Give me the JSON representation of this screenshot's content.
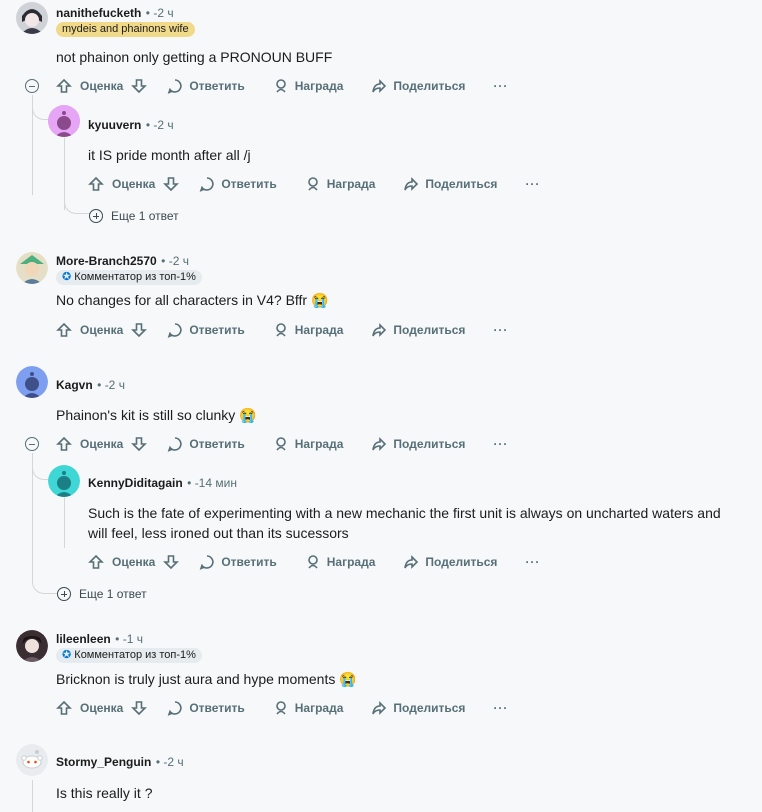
{
  "actions": {
    "vote": "Оценка",
    "reply": "Ответить",
    "award": "Награда",
    "share": "Поделиться",
    "more": "···"
  },
  "comments": [
    {
      "user": "nanithefucketh",
      "time": "-2 ч",
      "flair": "mydeis and phainons wife",
      "text": "not phainon only getting a PRONOUN BUFF",
      "replies": [
        {
          "user": "kyuuvern",
          "time": "-2 ч",
          "text": "it IS pride month after all /j"
        }
      ],
      "more_replies": "Еще 1 ответ"
    },
    {
      "user": "More-Branch2570",
      "time": "-2 ч",
      "flair": "Комментатор из топ-1%",
      "text": "No changes for all characters in V4? Bffr 😭"
    },
    {
      "user": "Kagvn",
      "time": "-2 ч",
      "text": "Phainon's kit is still so clunky 😭",
      "replies": [
        {
          "user": "KennyDiditagain",
          "time": "-14 мин",
          "text_line1": "Such is the fate of experimenting with a new mechanic the first unit is always on uncharted waters and",
          "text_line2": "will feel, less ironed out than its sucessors"
        }
      ],
      "more_replies": "Еще 1 ответ"
    },
    {
      "user": "lileenleen",
      "time": "-1 ч",
      "flair": "Комментатор из топ-1%",
      "text": "Bricknon is truly just aura and hype moments 😭"
    },
    {
      "user": "Stormy_Penguin",
      "time": "-2 ч",
      "text": "Is this really it ?"
    }
  ],
  "colors": {
    "background": "#f6f8fa",
    "meta": "#576f76",
    "flair_yellow": "#f1d98a",
    "flair_grey": "#e5ebee"
  }
}
